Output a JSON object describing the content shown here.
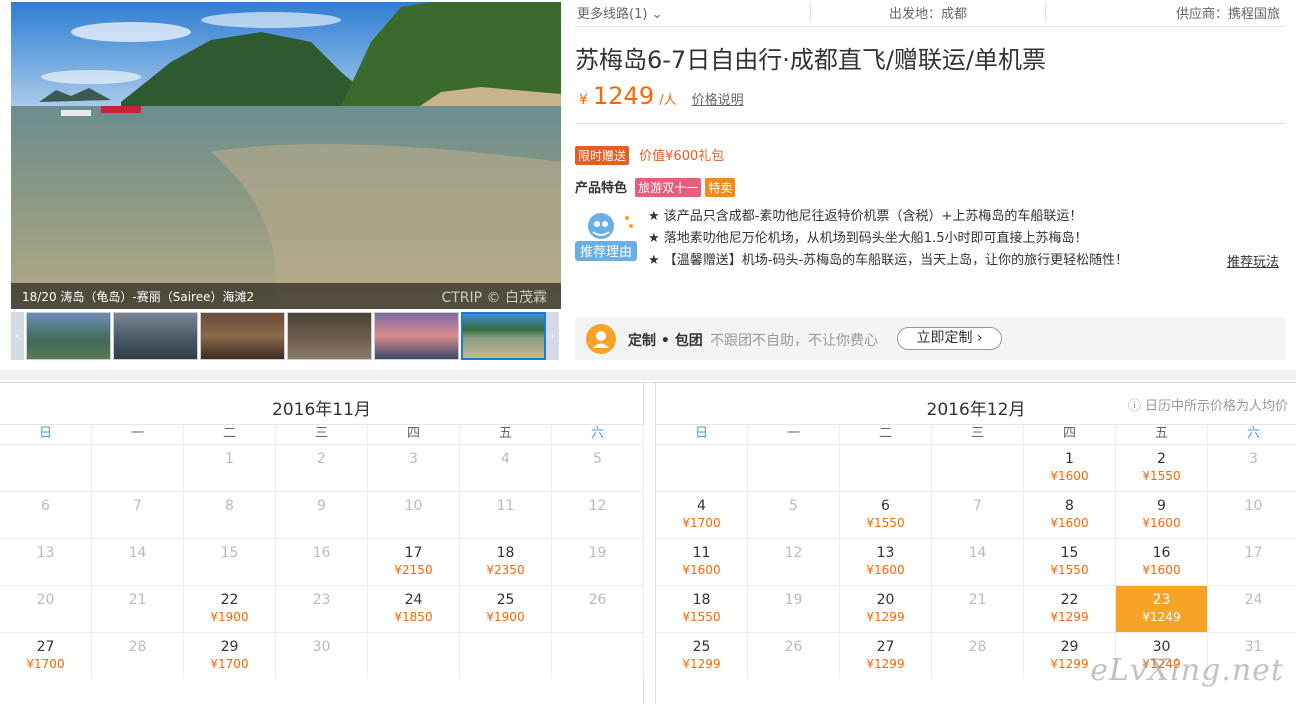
{
  "gallery": {
    "caption": "18/20 涛岛（龟岛）-赛丽（Sairee）海滩2",
    "watermark": "CTRIP © 白茂霖",
    "thumb_count": 6,
    "active_thumb": 6
  },
  "topbar": {
    "more_routes": "更多线路(1)",
    "departure": "出发地：成都",
    "supplier": "供应商：携程国旅"
  },
  "product": {
    "title": "苏梅岛6-7日自由行·成都直飞/赠联运/单机票",
    "currency": "¥",
    "price": "1249",
    "per": "/人",
    "price_explain": "价格说明",
    "gift_tag": "限时赠送",
    "gift_value": "价值¥600礼包",
    "feature_label": "产品特色",
    "feature_tags": [
      "旅游双十一",
      "特卖"
    ],
    "reason_icon_text": "推荐理由",
    "reasons": [
      "★ 该产品只含成都-素叻他尼往返特价机票（含税）+上苏梅岛的车船联运！",
      "★ 落地素叻他尼万伦机场，从机场到码头坐大船1.5小时即可直接上苏梅岛！",
      "★ 【温馨赠送】机场-码头-苏梅岛的车船联运，当天上岛，让你的旅行更轻松随性！"
    ],
    "play_link": "推荐玩法"
  },
  "custom": {
    "label": "定制 • 包团",
    "desc": "不跟团不自助，不让你费心",
    "button": "立即定制 ›"
  },
  "calendar_note": "ⓘ 日历中所示价格为人均价",
  "weekdays": [
    "日",
    "一",
    "二",
    "三",
    "四",
    "五",
    "六"
  ],
  "months": [
    {
      "title": "2016年11月",
      "cells": [
        {
          "d": "",
          "p": ""
        },
        {
          "d": "",
          "p": ""
        },
        {
          "d": "1",
          "p": ""
        },
        {
          "d": "2",
          "p": ""
        },
        {
          "d": "3",
          "p": ""
        },
        {
          "d": "4",
          "p": ""
        },
        {
          "d": "5",
          "p": ""
        },
        {
          "d": "6",
          "p": ""
        },
        {
          "d": "7",
          "p": ""
        },
        {
          "d": "8",
          "p": ""
        },
        {
          "d": "9",
          "p": ""
        },
        {
          "d": "10",
          "p": ""
        },
        {
          "d": "11",
          "p": ""
        },
        {
          "d": "12",
          "p": ""
        },
        {
          "d": "13",
          "p": ""
        },
        {
          "d": "14",
          "p": ""
        },
        {
          "d": "15",
          "p": ""
        },
        {
          "d": "16",
          "p": ""
        },
        {
          "d": "17",
          "p": "¥2150"
        },
        {
          "d": "18",
          "p": "¥2350"
        },
        {
          "d": "19",
          "p": ""
        },
        {
          "d": "20",
          "p": ""
        },
        {
          "d": "21",
          "p": ""
        },
        {
          "d": "22",
          "p": "¥1900"
        },
        {
          "d": "23",
          "p": ""
        },
        {
          "d": "24",
          "p": "¥1850"
        },
        {
          "d": "25",
          "p": "¥1900"
        },
        {
          "d": "26",
          "p": ""
        },
        {
          "d": "27",
          "p": "¥1700"
        },
        {
          "d": "28",
          "p": ""
        },
        {
          "d": "29",
          "p": "¥1700"
        },
        {
          "d": "30",
          "p": ""
        },
        {
          "d": "",
          "p": ""
        },
        {
          "d": "",
          "p": ""
        },
        {
          "d": "",
          "p": ""
        }
      ]
    },
    {
      "title": "2016年12月",
      "cells": [
        {
          "d": "",
          "p": ""
        },
        {
          "d": "",
          "p": ""
        },
        {
          "d": "",
          "p": ""
        },
        {
          "d": "",
          "p": ""
        },
        {
          "d": "1",
          "p": "¥1600"
        },
        {
          "d": "2",
          "p": "¥1550"
        },
        {
          "d": "3",
          "p": ""
        },
        {
          "d": "4",
          "p": "¥1700"
        },
        {
          "d": "5",
          "p": ""
        },
        {
          "d": "6",
          "p": "¥1550"
        },
        {
          "d": "7",
          "p": ""
        },
        {
          "d": "8",
          "p": "¥1600"
        },
        {
          "d": "9",
          "p": "¥1600"
        },
        {
          "d": "10",
          "p": ""
        },
        {
          "d": "11",
          "p": "¥1600"
        },
        {
          "d": "12",
          "p": ""
        },
        {
          "d": "13",
          "p": "¥1600"
        },
        {
          "d": "14",
          "p": ""
        },
        {
          "d": "15",
          "p": "¥1550"
        },
        {
          "d": "16",
          "p": "¥1600"
        },
        {
          "d": "17",
          "p": ""
        },
        {
          "d": "18",
          "p": "¥1550"
        },
        {
          "d": "19",
          "p": ""
        },
        {
          "d": "20",
          "p": "¥1299"
        },
        {
          "d": "21",
          "p": ""
        },
        {
          "d": "22",
          "p": "¥1299"
        },
        {
          "d": "23",
          "p": "¥1249",
          "selected": true
        },
        {
          "d": "24",
          "p": ""
        },
        {
          "d": "25",
          "p": "¥1299"
        },
        {
          "d": "26",
          "p": ""
        },
        {
          "d": "27",
          "p": "¥1299"
        },
        {
          "d": "28",
          "p": ""
        },
        {
          "d": "29",
          "p": "¥1299"
        },
        {
          "d": "30",
          "p": "¥1249"
        },
        {
          "d": "31",
          "p": ""
        }
      ]
    }
  ],
  "site_watermark": "eLvXing.net"
}
